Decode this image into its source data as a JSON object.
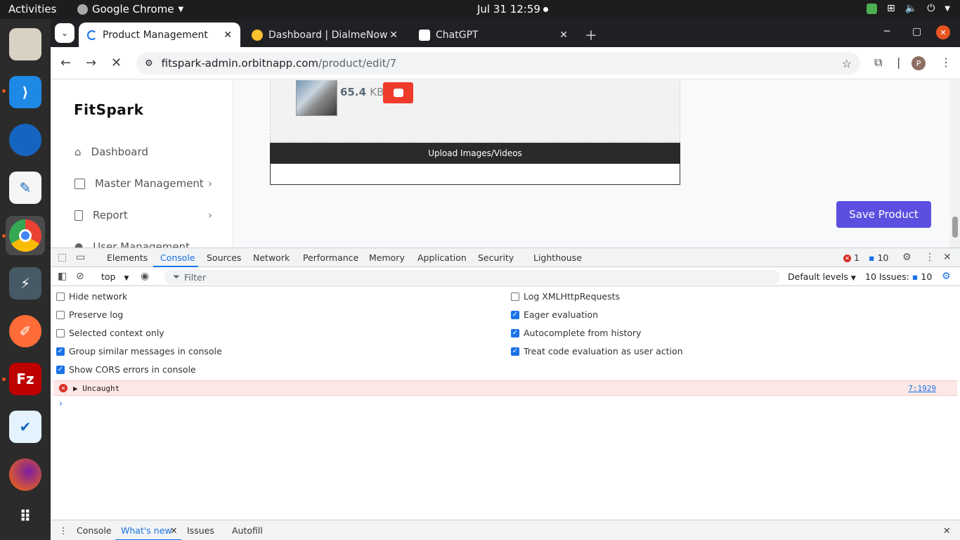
{
  "system": {
    "activities": "Activities",
    "app_name": "Google Chrome",
    "clock": "Jul 31  12:59"
  },
  "browser": {
    "tabs": [
      {
        "title": "Product Management",
        "active": true
      },
      {
        "title": "Dashboard | DialmeNow",
        "active": false
      },
      {
        "title": "ChatGPT",
        "active": false
      }
    ],
    "url_host": "fitspark-admin.orbitnapp.com",
    "url_path": "/product/edit/7",
    "profile_initial": "P"
  },
  "app": {
    "logo": "FitSpark",
    "nav": [
      {
        "label": "Dashboard",
        "has_chevron": false
      },
      {
        "label": "Master Management",
        "has_chevron": true
      },
      {
        "label": "Report",
        "has_chevron": true
      },
      {
        "label": "User Management",
        "has_chevron": false
      }
    ],
    "file_size_value": "65.4",
    "file_size_unit": "KB",
    "upload_label": "Upload Images/Videos",
    "save_label": "Save Product",
    "accent_color": "#5b4fe0"
  },
  "devtools": {
    "tabs": [
      "Elements",
      "Console",
      "Sources",
      "Network",
      "Performance",
      "Memory",
      "Application",
      "Security",
      "Lighthouse"
    ],
    "active_tab": "Console",
    "error_count": "1",
    "message_count": "10",
    "context": "top",
    "filter_placeholder": "Filter",
    "levels": "Default levels",
    "issues_label": "10 Issues:",
    "issues_count": "10",
    "options_left": [
      {
        "label": "Hide network",
        "checked": false
      },
      {
        "label": "Preserve log",
        "checked": false
      },
      {
        "label": "Selected context only",
        "checked": false
      },
      {
        "label": "Group similar messages in console",
        "checked": true
      },
      {
        "label": "Show CORS errors in console",
        "checked": true
      }
    ],
    "options_right": [
      {
        "label": "Log XMLHttpRequests",
        "checked": false
      },
      {
        "label": "Eager evaluation",
        "checked": true
      },
      {
        "label": "Autocomplete from history",
        "checked": true
      },
      {
        "label": "Treat code evaluation as user action",
        "checked": true
      }
    ],
    "error_text": "Uncaught",
    "error_location": "7:1929",
    "drawer_tabs": [
      "Console",
      "What's new",
      "Issues",
      "Autofill"
    ],
    "drawer_active": "What's new"
  }
}
